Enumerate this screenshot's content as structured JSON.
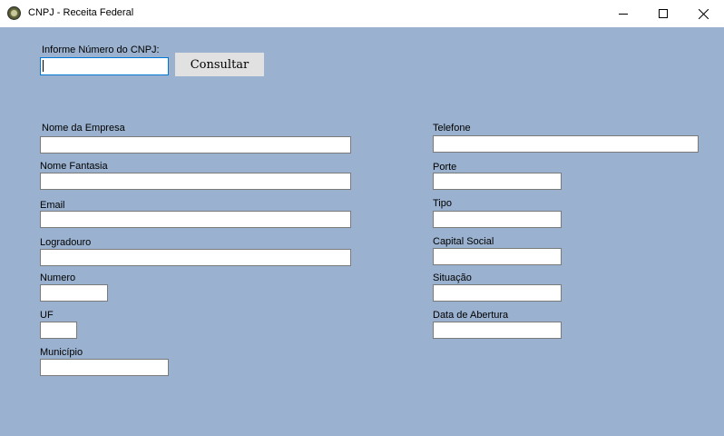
{
  "window": {
    "title": "CNPJ - Receita Federal",
    "app_icon": "seal-icon",
    "controls": [
      "minimize-icon",
      "maximize-icon",
      "close-icon"
    ]
  },
  "search": {
    "label": "Informe Número do CNPJ:",
    "value": "",
    "button_label": "Consultar"
  },
  "left_fields": {
    "nome_empresa": {
      "label": "Nome da Empresa",
      "value": ""
    },
    "nome_fantasia": {
      "label": "Nome Fantasia",
      "value": ""
    },
    "email": {
      "label": "Email",
      "value": ""
    },
    "logradouro": {
      "label": "Logradouro",
      "value": ""
    },
    "numero": {
      "label": "Numero",
      "value": ""
    },
    "uf": {
      "label": "UF",
      "value": ""
    },
    "municipio": {
      "label": "Município",
      "value": ""
    }
  },
  "right_fields": {
    "telefone": {
      "label": "Telefone",
      "value": ""
    },
    "porte": {
      "label": "Porte",
      "value": ""
    },
    "tipo": {
      "label": "Tipo",
      "value": ""
    },
    "capital_social": {
      "label": "Capital Social",
      "value": ""
    },
    "situacao": {
      "label": "Situação",
      "value": ""
    },
    "data_abertura": {
      "label": "Data de Abertura",
      "value": ""
    }
  },
  "colors": {
    "form_background": "#9ab2cf",
    "focus_border": "#0078d7",
    "button_background": "#e1e1e1"
  }
}
